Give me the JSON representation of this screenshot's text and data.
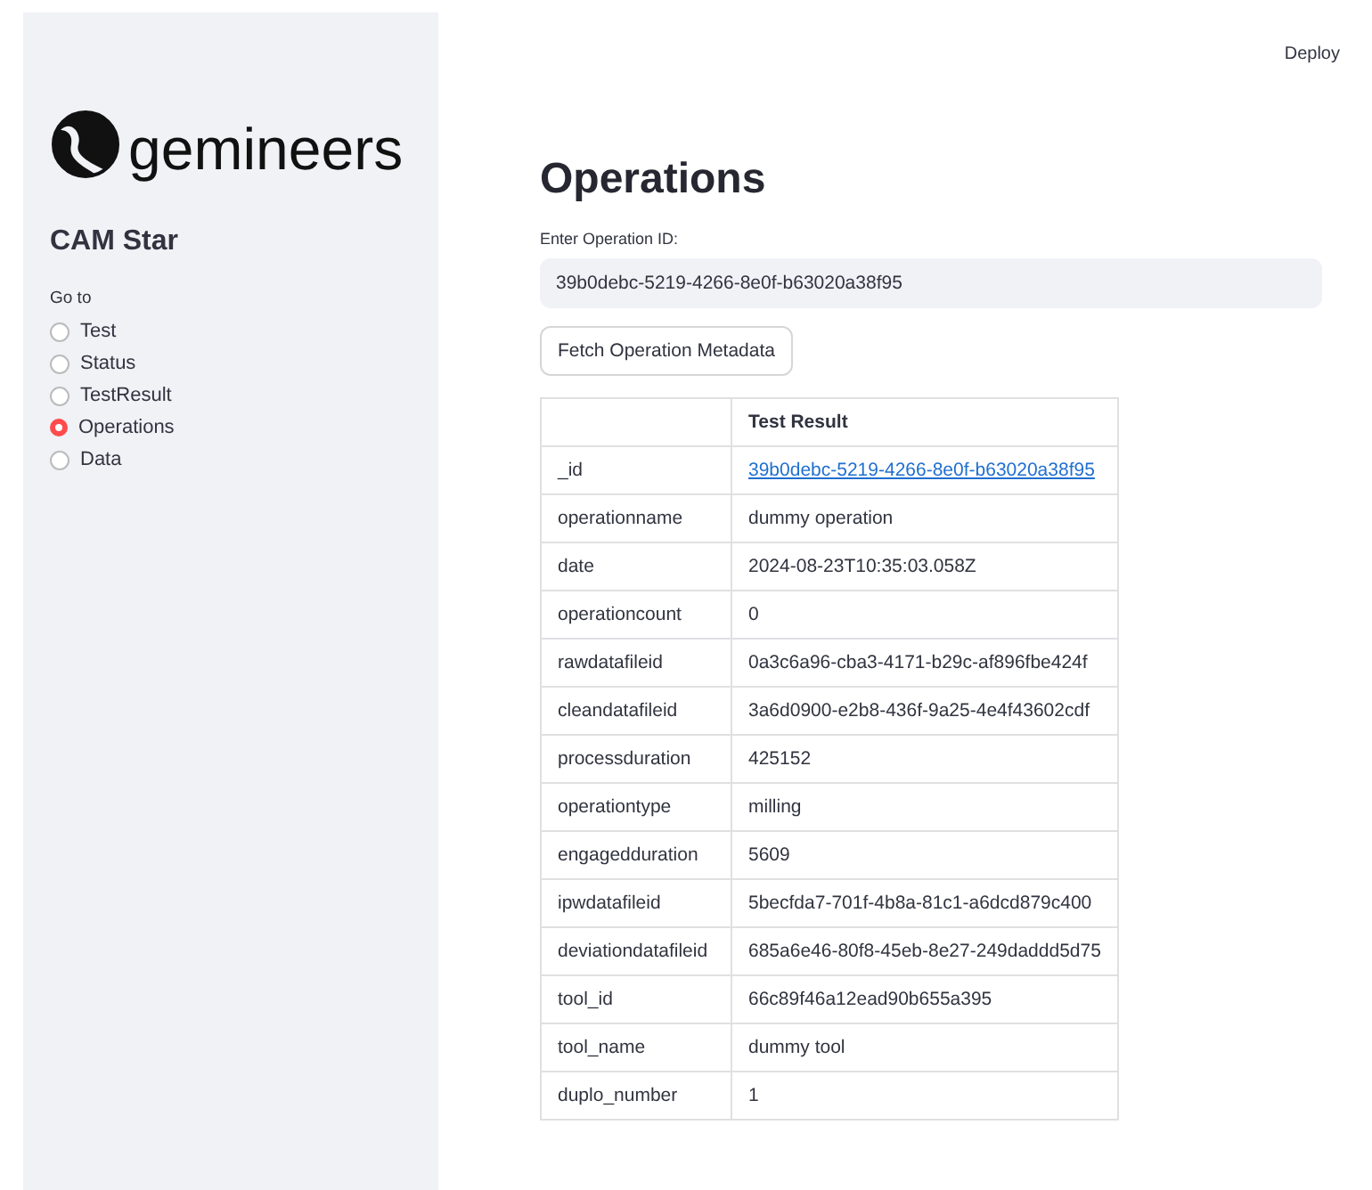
{
  "header": {
    "deploy": "Deploy"
  },
  "sidebar": {
    "logo_text": "gemineers",
    "title": "CAM Star",
    "nav_label": "Go to",
    "items": [
      {
        "label": "Test",
        "selected": false
      },
      {
        "label": "Status",
        "selected": false
      },
      {
        "label": "TestResult",
        "selected": false
      },
      {
        "label": "Operations",
        "selected": true
      },
      {
        "label": "Data",
        "selected": false
      }
    ]
  },
  "main": {
    "title": "Operations",
    "field": {
      "label": "Enter Operation ID:",
      "value": "39b0debc-5219-4266-8e0f-b63020a38f95"
    },
    "button": "Fetch Operation Metadata",
    "table": {
      "columns": [
        "Test Result"
      ],
      "rows": [
        {
          "key": "_id",
          "value": "39b0debc-5219-4266-8e0f-b63020a38f95",
          "kind": "link"
        },
        {
          "key": "operationname",
          "value": "dummy operation",
          "kind": "text"
        },
        {
          "key": "date",
          "value": "2024-08-23T10:35:03.058Z",
          "kind": "text"
        },
        {
          "key": "operationcount",
          "value": "0",
          "kind": "text"
        },
        {
          "key": "rawdatafileid",
          "value": "0a3c6a96-cba3-4171-b29c-af896fbe424f",
          "kind": "text"
        },
        {
          "key": "cleandatafileid",
          "value": "3a6d0900-e2b8-436f-9a25-4e4f43602cdf",
          "kind": "text"
        },
        {
          "key": "processduration",
          "value": "425152",
          "kind": "text"
        },
        {
          "key": "operationtype",
          "value": "milling",
          "kind": "text"
        },
        {
          "key": "engagedduration",
          "value": "5609",
          "kind": "text"
        },
        {
          "key": "ipwdatafileid",
          "value": "5becfda7-701f-4b8a-81c1-a6dcd879c400",
          "kind": "text"
        },
        {
          "key": "deviationdatafileid",
          "value": "685a6e46-80f8-45eb-8e27-249daddd5d75",
          "kind": "text"
        },
        {
          "key": "tool_id",
          "value": "66c89f46a12ead90b655a395",
          "kind": "text"
        },
        {
          "key": "tool_name",
          "value": "dummy tool",
          "kind": "text"
        },
        {
          "key": "duplo_number",
          "value": "1",
          "kind": "text"
        }
      ]
    }
  }
}
